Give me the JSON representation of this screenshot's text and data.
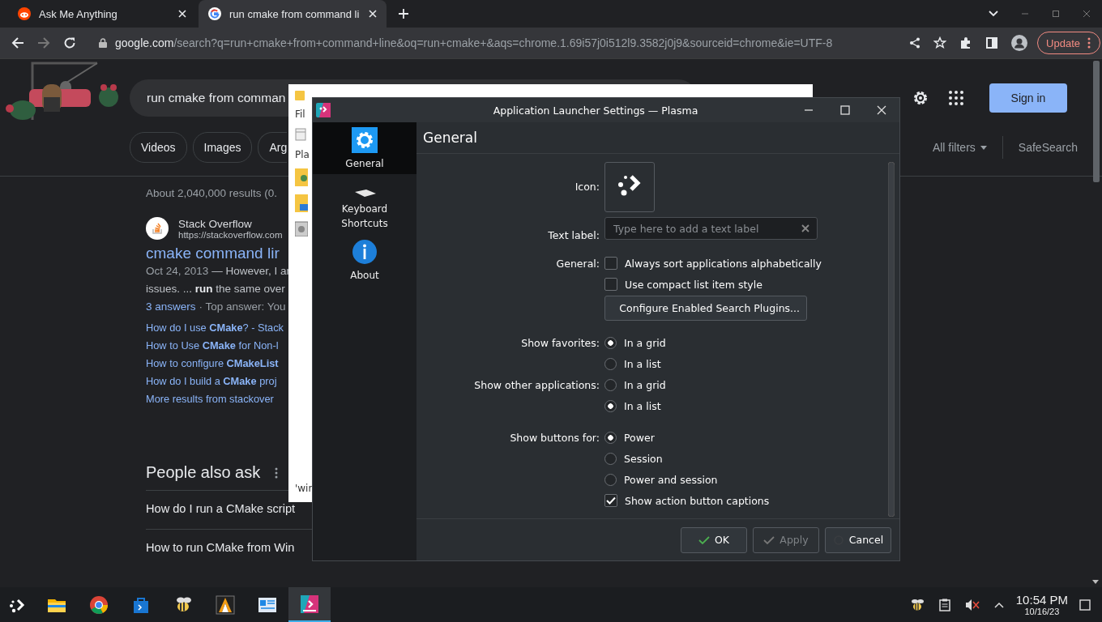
{
  "browser": {
    "tabs": [
      {
        "title": "Ask Me Anything",
        "kind": "reddit",
        "selected": false
      },
      {
        "title": "run cmake from command li",
        "kind": "google",
        "selected": true
      }
    ],
    "address": {
      "domain": "google.com",
      "path": "/search?q=run+cmake+from+command+line&oq=run+cmake+&aqs=chrome.1.69i57j0i512l9.3582j0j9&sourceid=chrome&ie=UTF-8"
    },
    "update_button": "Update"
  },
  "google": {
    "query": "run cmake from comman",
    "chips": [
      "Videos",
      "Images",
      "Arg"
    ],
    "sign_in": "Sign in",
    "all_filters": "All filters",
    "safesearch": "SafeSearch",
    "result_stats": "About 2,040,000 results (0.",
    "result": {
      "site": "Stack Overflow",
      "url": "https://stackoverflow.com",
      "title": "cmake command lir",
      "date": "Oct 24, 2013",
      "snippet": "— However, I ar",
      "snippet_2": "issues. ... **run** the same over",
      "answers": "3 answers",
      "top_answer": "· Top answer: You",
      "links": [
        "How do I use **CMake**? - Stack",
        "How to Use **CMake** for Non-l",
        "How to configure **CMakeList**",
        "How do I build a **CMake** proj",
        "More results from stackover"
      ]
    },
    "people_also_ask": {
      "title": "People also ask",
      "questions": [
        "How do I run a CMake script",
        "How to run CMake from Win"
      ]
    }
  },
  "file_manager": {
    "menu": "Fil",
    "places": "Pla",
    "status": "'wir"
  },
  "dialog": {
    "title": "Application Launcher Settings — Plasma",
    "sidebar": [
      {
        "label": "General",
        "kind": "gear",
        "selected": true
      },
      {
        "label": "Keyboard Shortcuts",
        "kind": "keyboard",
        "selected": false
      },
      {
        "label": "About",
        "kind": "info",
        "selected": false
      }
    ],
    "page_title": "General",
    "form_groups": [
      {
        "rows": [
          {
            "kind": "icon_button",
            "label": "Icon:"
          },
          {
            "kind": "text_field",
            "label": "Text label:",
            "placeholder": "Type here to add a text label"
          },
          {
            "kind": "checkbox",
            "label": "General:",
            "text": "Always sort applications alphabetically",
            "checked": false
          },
          {
            "kind": "checkbox",
            "text": "Use compact list item style",
            "checked": false
          },
          {
            "kind": "button",
            "text": "Configure Enabled Search Plugins..."
          }
        ]
      },
      {
        "rows": [
          {
            "kind": "radio",
            "label": "Show favorites:",
            "text": "In a grid",
            "selected": true
          },
          {
            "kind": "radio",
            "text": "In a list",
            "selected": false
          },
          {
            "kind": "radio",
            "label": "Show other applications:",
            "text": "In a grid",
            "selected": false
          },
          {
            "kind": "radio",
            "text": "In a list",
            "selected": true
          }
        ]
      },
      {
        "rows": [
          {
            "kind": "radio",
            "label": "Show buttons for:",
            "text": "Power",
            "selected": true
          },
          {
            "kind": "radio",
            "text": "Session",
            "selected": false
          },
          {
            "kind": "radio",
            "text": "Power and session",
            "selected": false
          },
          {
            "kind": "checkbox",
            "text": "Show action button captions",
            "checked": true
          }
        ]
      }
    ],
    "buttons": [
      {
        "label": "OK",
        "kind": "ok",
        "disabled": false
      },
      {
        "label": "Apply",
        "kind": "apply",
        "disabled": true
      },
      {
        "label": "Cancel",
        "kind": "cancel",
        "disabled": false
      }
    ]
  },
  "taskbar": {
    "items": [
      {
        "kind": "launcher",
        "selected": false
      },
      {
        "kind": "folder",
        "selected": false
      },
      {
        "kind": "chrome",
        "selected": false
      },
      {
        "kind": "store",
        "selected": false
      },
      {
        "kind": "bee",
        "selected": false
      },
      {
        "kind": "kite",
        "selected": false
      },
      {
        "kind": "presentation",
        "selected": false
      },
      {
        "kind": "plasma",
        "selected": true
      }
    ],
    "tray": [
      {
        "kind": "bee"
      },
      {
        "kind": "clipboard"
      },
      {
        "kind": "muted"
      },
      {
        "kind": "caret"
      }
    ],
    "time": "10:54 PM",
    "date": "10/16/23"
  }
}
